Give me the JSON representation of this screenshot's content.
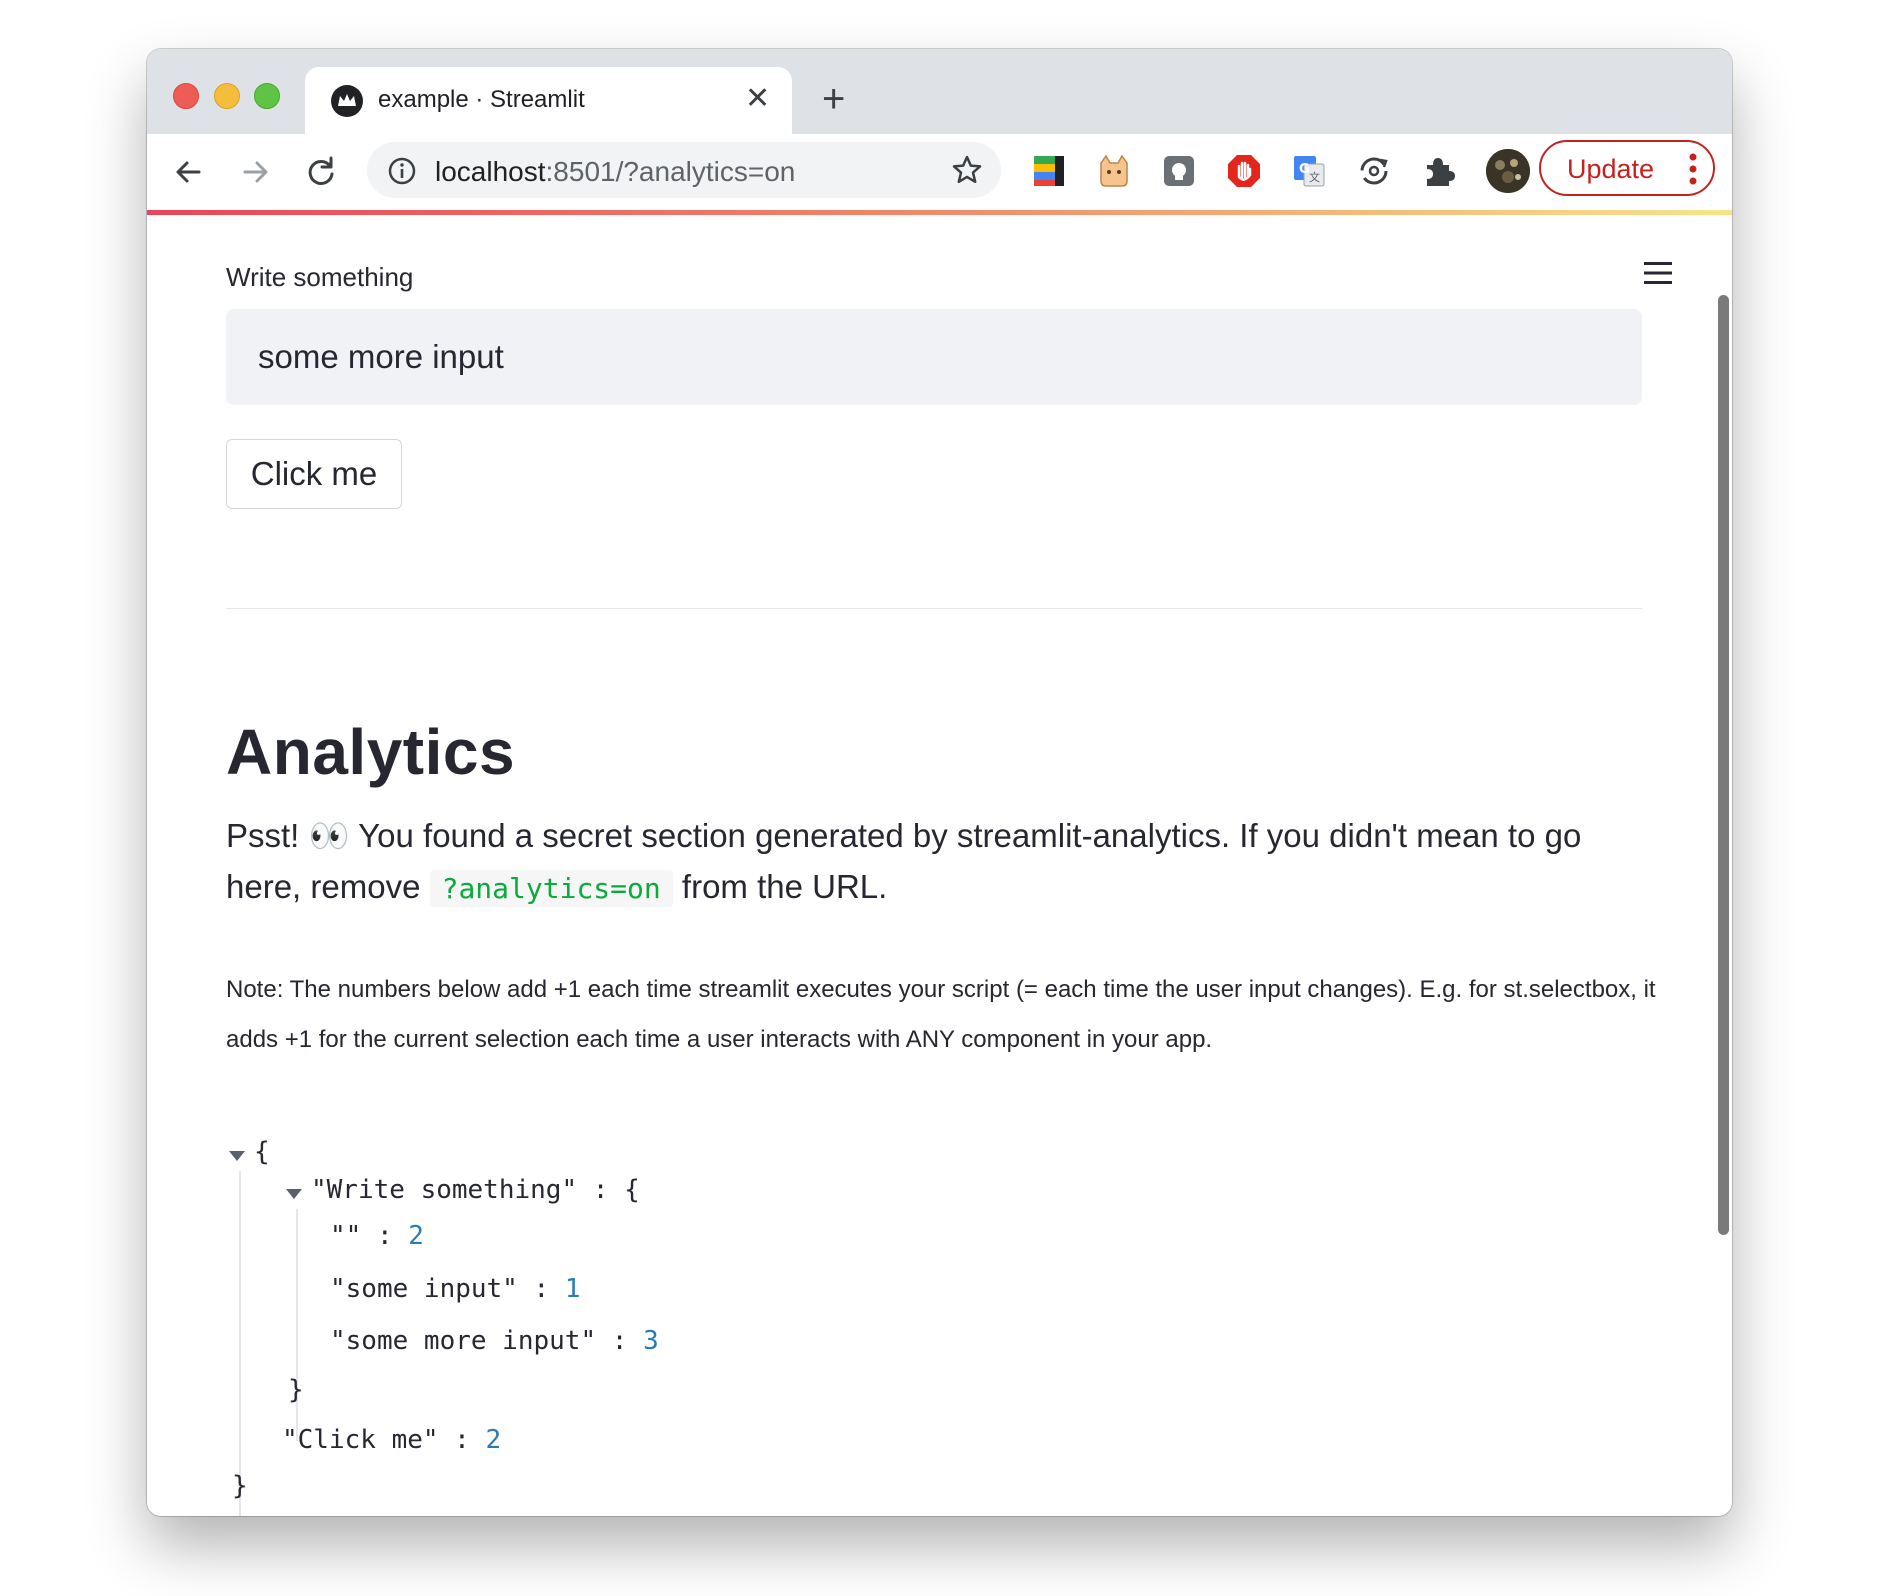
{
  "browser": {
    "tab_title": "example · Streamlit",
    "url_host": "localhost",
    "url_rest": ":8501/?analytics=on",
    "update_label": "Update"
  },
  "app": {
    "input_label": "Write something",
    "input_value": "some more input",
    "button_label": "Click me",
    "heading": "Analytics",
    "psst_prefix": "Psst! 👀 You found a secret section generated by streamlit-analytics. If you didn't mean to go here, remove ",
    "psst_code": "?analytics=on",
    "psst_suffix": " from the URL.",
    "note": "Note: The numbers below add +1 each time streamlit executes your script (= each time the user input changes). E.g. for st.selectbox, it adds +1 for the current selection each time a user interacts with ANY component in your app."
  },
  "json_view": {
    "open_brace": "{",
    "close_brace": "}",
    "write_key": "\"Write something\" : {",
    "write_close": "}",
    "entries": [
      {
        "key": "\"\" : ",
        "value": "2"
      },
      {
        "key": "\"some input\" : ",
        "value": "1"
      },
      {
        "key": "\"some more input\" : ",
        "value": "3"
      }
    ],
    "click_key": "\"Click me\" : ",
    "click_value": "2"
  },
  "colors": {
    "accent_red": "#c5221f",
    "code_green": "#09ab3b",
    "number_blue": "#2a7ab6",
    "input_bg": "#f0f2f6"
  }
}
